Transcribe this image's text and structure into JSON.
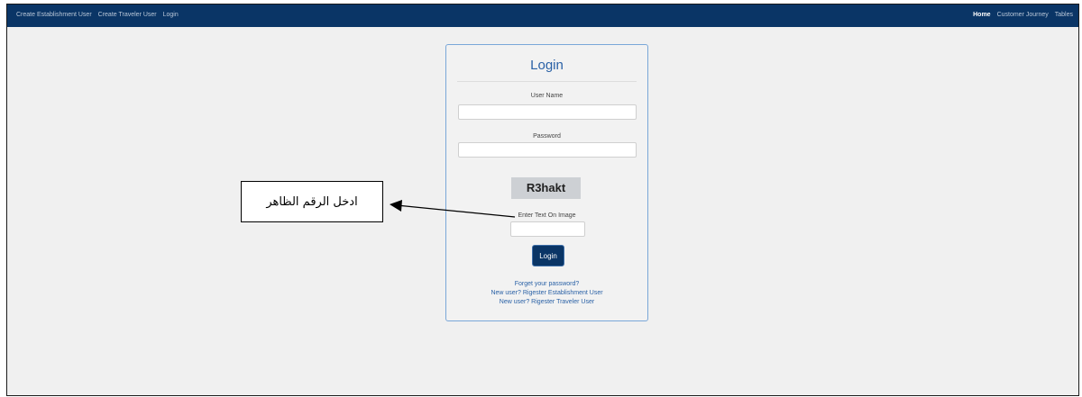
{
  "nav": {
    "left_links": [
      "Create Establishment User",
      "Create Traveler User",
      "Login"
    ],
    "right_links": [
      "Home",
      "Customer Journey",
      "Tables"
    ],
    "active": "Home"
  },
  "login": {
    "title": "Login",
    "username_label": "User Name",
    "password_label": "Password",
    "captcha_text": "R3hakt",
    "captcha_label": "Enter Text On Image",
    "button_label": "Login",
    "links": {
      "forgot": "Forget your password?",
      "register_establishment": "New user? Rigester Establishment User",
      "register_traveler": "New user? Rigester Traveler User"
    }
  },
  "annotation": {
    "callout_text": "ادخل الرقم الظاهر"
  },
  "colors": {
    "navbar": "#0a3566",
    "accent": "#2a61a6",
    "background": "#f0f0f0"
  }
}
